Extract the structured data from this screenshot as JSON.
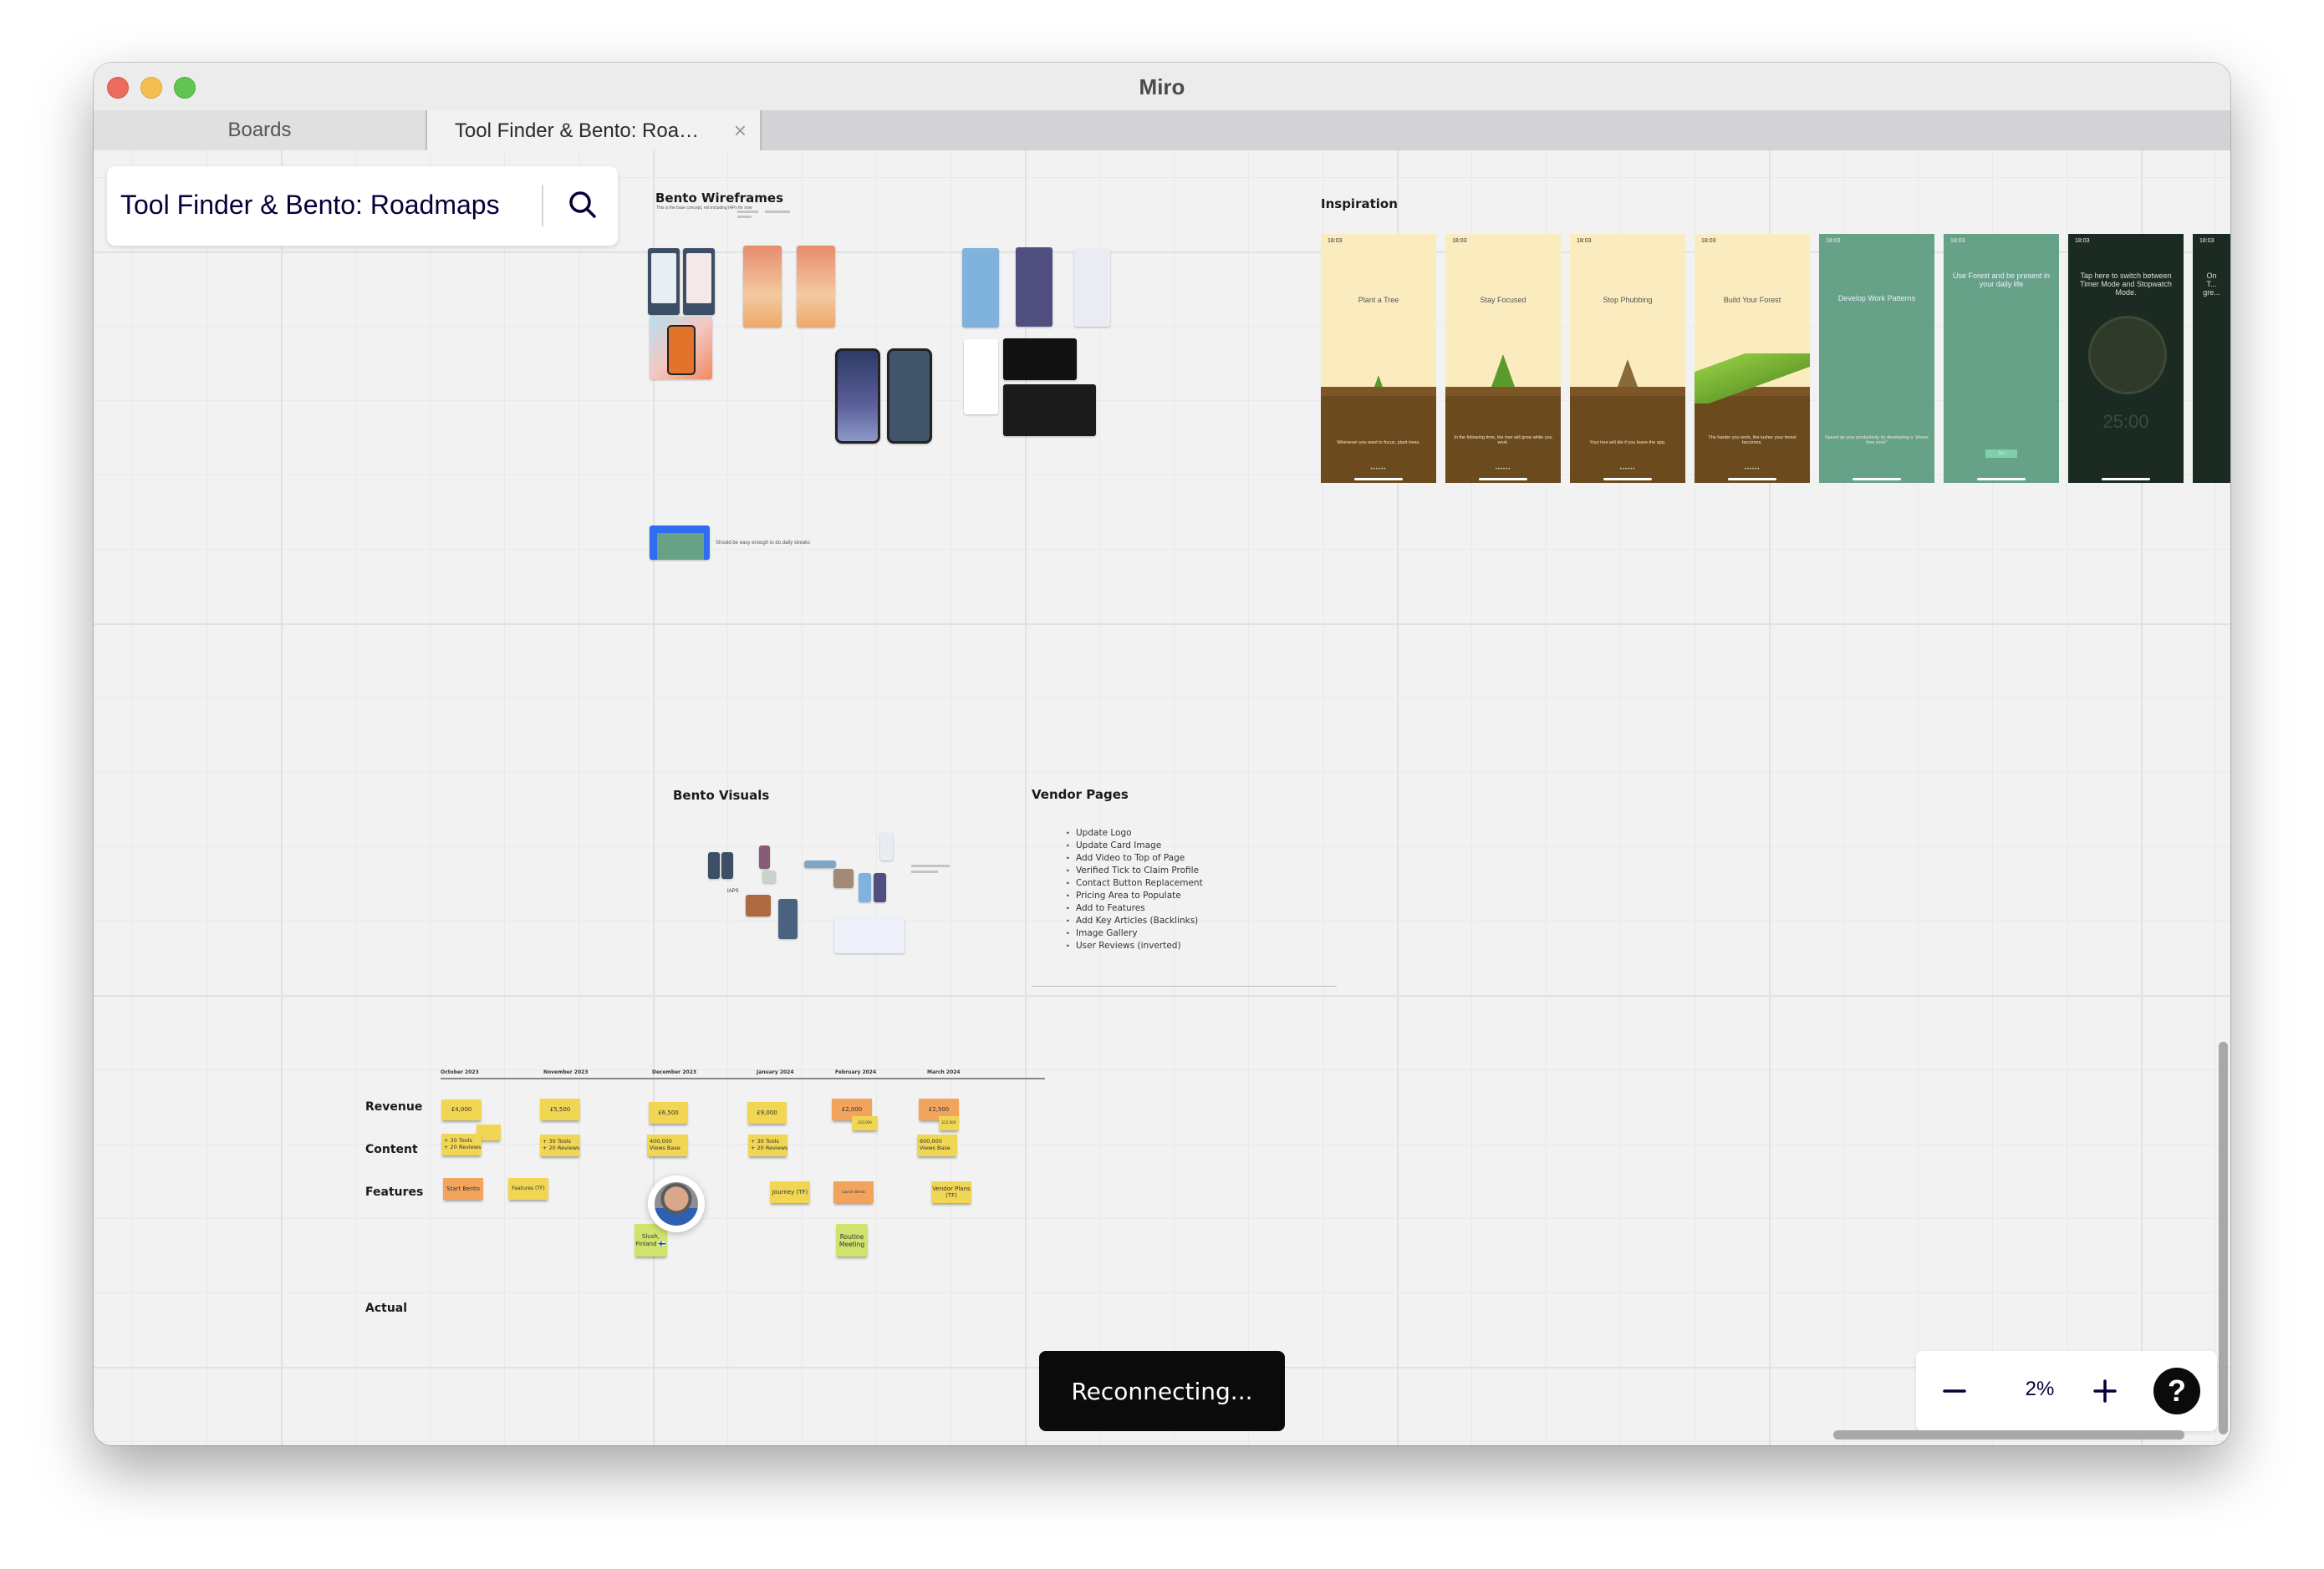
{
  "window": {
    "title": "Miro"
  },
  "tabs": [
    {
      "label": "Boards",
      "active": false
    },
    {
      "label": "Tool Finder & Bento: Roa…",
      "active": true
    }
  ],
  "board": {
    "name": "Tool Finder & Bento: Roadmaps"
  },
  "frames": {
    "bento_wireframes": {
      "title": "Bento Wireframes",
      "subtitle": "This is the base concept, not including IAPs for now",
      "note": "Should be easy enough to do daily streaks"
    },
    "inspiration": {
      "title": "Inspiration",
      "screens": [
        {
          "heading": "Plant a Tree",
          "caption": "Whenever you want to focus, plant trees.",
          "theme": "light"
        },
        {
          "heading": "Stay Focused",
          "caption": "In the following time, the tree will grow while you work.",
          "theme": "light"
        },
        {
          "heading": "Stop Phubbing",
          "caption": "Your tree will die if you leave the app.",
          "theme": "light"
        },
        {
          "heading": "Build Your Forest",
          "caption": "The harder you work, the lusher your forest becomes.",
          "theme": "light"
        },
        {
          "heading": "Develop Work Patterns",
          "caption": "Speed up your productivity by developing a \"phone free zone\"",
          "theme": "green"
        },
        {
          "heading": "Use Forest and be present in your daily life",
          "caption": "Go",
          "theme": "green"
        },
        {
          "heading": "Tap here to switch between Timer Mode and Stopwatch Mode.",
          "caption": "25:00",
          "theme": "dark"
        },
        {
          "heading": "On T... gre...",
          "caption": "",
          "theme": "dark"
        }
      ],
      "status_time": "18:03"
    },
    "bento_visuals": {
      "title": "Bento Visuals",
      "label": "IAPS"
    },
    "vendor_pages": {
      "title": "Vendor Pages",
      "items": [
        "Update Logo",
        "Update Card Image",
        "Add Video to Top of Page",
        "Verified Tick to Claim Profile",
        "Contact Button Replacement",
        "Pricing Area to Populate",
        "Add to Features",
        "Add Key Articles (Backlinks)",
        "Image Gallery",
        "User Reviews (inverted)"
      ]
    }
  },
  "roadmap": {
    "months": [
      "October 2023",
      "November 2023",
      "December 2023",
      "January 2024",
      "February 2024",
      "March 2024"
    ],
    "rows": [
      "Revenue",
      "Content",
      "Features",
      "Actual"
    ],
    "stickies": {
      "revenue": [
        "£4,000",
        "£5,500",
        "£6,500",
        "£9,000",
        "£2,000",
        "£10,000",
        "£2,500",
        "£12,000"
      ],
      "content": [
        "+ 30 Tools\n+ 20 Reviews",
        "",
        "+ 30 Tools\n+ 20 Reviews",
        "400,000\nViews Base",
        "+ 30 Tools\n+ 20 Reviews",
        "600,000\nViews Base"
      ],
      "features": [
        "Start Bento",
        "Features (TF)",
        "Journey (TF)",
        "Launch Bento",
        "Vendor Plans (TF)"
      ],
      "events": [
        "Slush, Finland 🇫🇮",
        "Routine Meeting"
      ]
    }
  },
  "colors": {
    "sticky_yellow": "#f0d653",
    "sticky_orange": "#f2a45c",
    "sticky_green": "#cfe36d",
    "miro_navy": "#050038"
  },
  "status": {
    "toast": "Reconnecting..."
  },
  "zoom_controls": {
    "level": "2%",
    "zoom_out_icon": "minus-icon",
    "zoom_in_icon": "plus-icon",
    "help_icon": "question-icon"
  }
}
